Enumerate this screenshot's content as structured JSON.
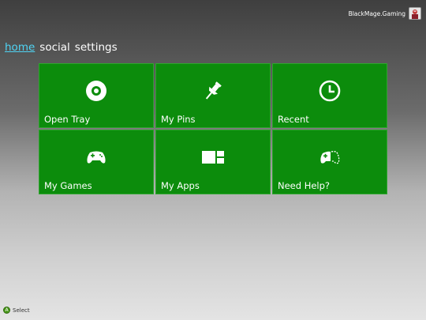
{
  "profile": {
    "gamertag": "BlackMage.Gaming",
    "avatar_icon": "avatar-icon"
  },
  "nav": [
    {
      "label": "home",
      "active": true
    },
    {
      "label": "social",
      "active": false
    },
    {
      "label": "settings",
      "active": false
    }
  ],
  "tiles": [
    {
      "label": "Open Tray",
      "icon": "disc-icon"
    },
    {
      "label": "My Pins",
      "icon": "pin-icon"
    },
    {
      "label": "Recent",
      "icon": "clock-icon"
    },
    {
      "label": "My Games",
      "icon": "controller-icon"
    },
    {
      "label": "My Apps",
      "icon": "apps-icon"
    },
    {
      "label": "Need Help?",
      "icon": "help-controller-icon"
    }
  ],
  "footer": {
    "button_glyph": "A",
    "action_label": "Select"
  },
  "colors": {
    "tile": "#0c8c0c",
    "nav_active": "#4fd4f4"
  }
}
